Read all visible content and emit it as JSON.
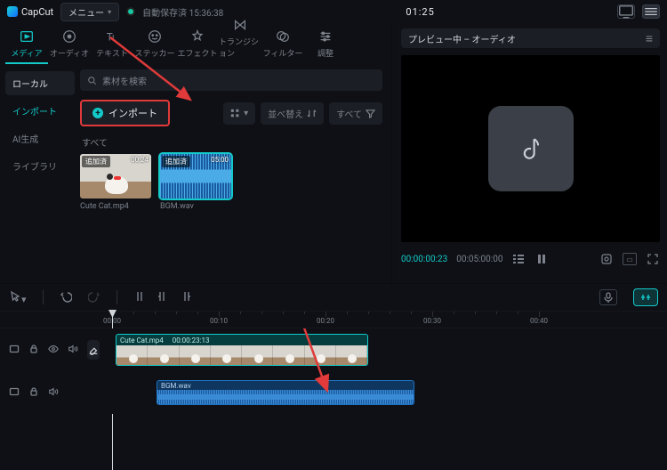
{
  "app": {
    "name": "CapCut",
    "menu_label": "メニュー"
  },
  "autosave": {
    "label": "自動保存済",
    "time": "15:36:38"
  },
  "timecode_top": "01:25",
  "work_tabs": [
    {
      "label": "メディア",
      "icon": "media"
    },
    {
      "label": "オーディオ",
      "icon": "audio"
    },
    {
      "label": "テキスト",
      "icon": "text"
    },
    {
      "label": "ステッカー",
      "icon": "sticker"
    },
    {
      "label": "エフェクト",
      "icon": "effect"
    },
    {
      "label": "トランジション",
      "icon": "transition"
    },
    {
      "label": "フィルター",
      "icon": "filter"
    },
    {
      "label": "調整",
      "icon": "adjust"
    }
  ],
  "side_tabs": {
    "head": "ローカル",
    "items": [
      "インポート",
      "AI生成",
      "ライブラリ"
    ],
    "active_index": 0
  },
  "search": {
    "placeholder": "素材を検索"
  },
  "import_button": "インポート",
  "toolbar_right": {
    "view": "表示",
    "sort": "並べ替え",
    "all": "すべて"
  },
  "media_subhead": "すべて",
  "clips": [
    {
      "badge": "追加済",
      "duration": "00:24",
      "name": "Cute Cat.mp4",
      "type": "video"
    },
    {
      "badge": "追加済",
      "duration": "05:00",
      "name": "BGM.wav",
      "type": "audio",
      "selected": true
    }
  ],
  "preview": {
    "title": "プレビュー中 – オーディオ",
    "current": "00:00:00:23",
    "total": "00:05:00:00"
  },
  "timeline_toolbar": {
    "caption_btn": "⇄"
  },
  "ruler": {
    "marks": [
      "00:00",
      "00:10",
      "00:20",
      "00:30",
      "00:40"
    ]
  },
  "tracks": {
    "video": {
      "clip_name": "Cute Cat.mp4",
      "clip_dur": "00:00:23:13"
    },
    "audio": {
      "clip_name": "BGM.wav"
    }
  }
}
